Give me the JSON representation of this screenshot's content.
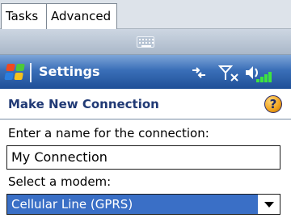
{
  "tabs": [
    {
      "label": "Tasks"
    },
    {
      "label": "Advanced"
    }
  ],
  "titlebar": {
    "title": "Settings",
    "icons": [
      "start-logo-icon",
      "connectivity-icon",
      "signal-off-icon",
      "volume-icon"
    ],
    "volume_color": "#3ee43e"
  },
  "section": {
    "title": "Make New Connection",
    "help_icon": "?"
  },
  "form": {
    "name_label": "Enter a name for the connection:",
    "name_value": "My Connection",
    "modem_label": "Select a modem:",
    "modem_selected": "Cellular Line (GPRS)"
  },
  "colors": {
    "title_bar": "#3a6fb8",
    "selection": "#3a6fc6",
    "section_title": "#213a75"
  }
}
